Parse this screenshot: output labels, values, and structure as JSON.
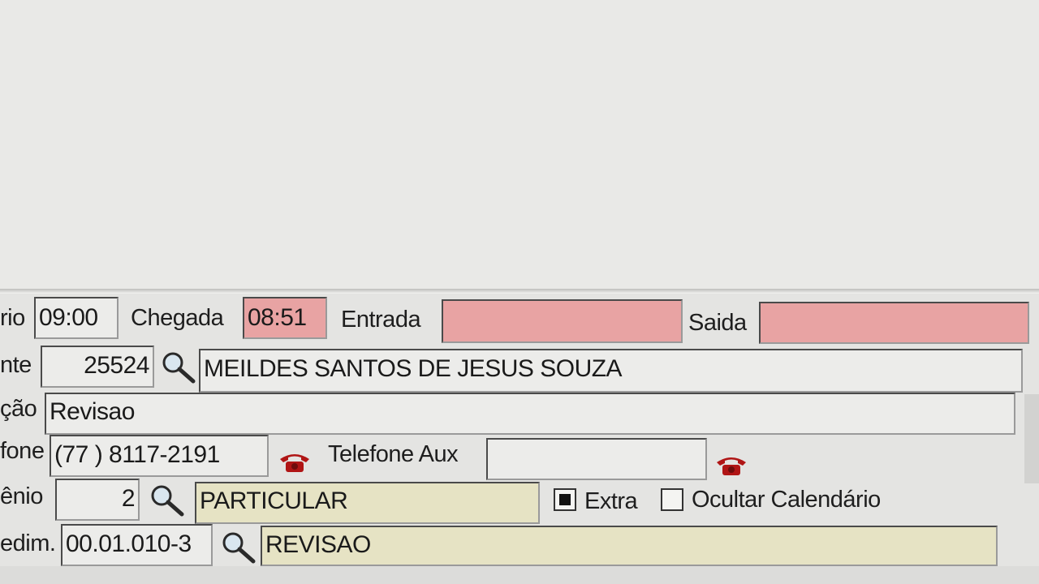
{
  "form": {
    "horario": {
      "label": "rio",
      "value": "09:00"
    },
    "chegada": {
      "label": "Chegada",
      "value": "08:51"
    },
    "entrada": {
      "label": "Entrada",
      "value": ""
    },
    "saida": {
      "label": "Saida",
      "value": ""
    },
    "paciente": {
      "label": "nte",
      "code": "25524",
      "name": "MEILDES SANTOS DE JESUS SOUZA"
    },
    "observacao": {
      "label": "ção",
      "value": "Revisao"
    },
    "telefone": {
      "label": "fone",
      "value": "(77 ) 8117-2191"
    },
    "telefone_aux": {
      "label": "Telefone Aux",
      "value": ""
    },
    "convenio": {
      "label": "ênio",
      "code": "2",
      "name": "PARTICULAR"
    },
    "extra": {
      "label": "Extra",
      "checked": true
    },
    "ocultar_calendario": {
      "label": "Ocultar Calendário",
      "checked": false
    },
    "procedimento": {
      "label": "edim.",
      "code": "00.01.010-3",
      "name": "REVISAO"
    }
  },
  "icons": {
    "search": "search-icon",
    "phone": "phone-icon"
  },
  "colors": {
    "pink_field": "#e8a3a3",
    "yellow_field": "#e6e3c4",
    "phone_icon": "#b01515"
  }
}
